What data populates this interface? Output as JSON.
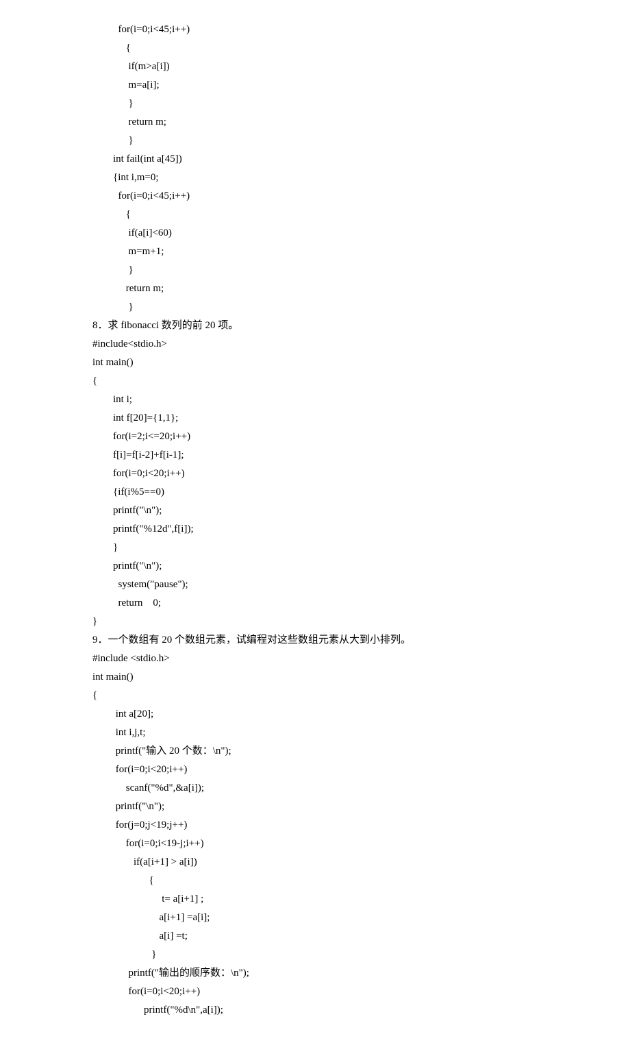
{
  "lines": [
    "          for(i=0;i<45;i++)",
    "             {",
    "              if(m>a[i])",
    "              m=a[i];",
    "              }",
    "              return m;",
    "              }",
    "        int fail(int a[45])",
    "        {int i,m=0;",
    "          for(i=0;i<45;i++)",
    "             {",
    "              if(a[i]<60)",
    "              m=m+1;",
    "              }",
    "             return m;",
    "              }",
    "",
    "8．求 fibonacci 数列的前 20 项。",
    "#include<stdio.h>",
    "int main()",
    "{",
    "        int i;",
    "        int f[20]={1,1};",
    "        for(i=2;i<=20;i++)",
    "        f[i]=f[i-2]+f[i-1];",
    "        for(i=0;i<20;i++)",
    "        {if(i%5==0)",
    "        printf(\"\\n\");",
    "        printf(\"%12d\",f[i]);",
    "        }",
    "        printf(\"\\n\");",
    "          system(\"pause\");",
    "          return    0;",
    "}",
    "9．一个数组有 20 个数组元素，试编程对这些数组元素从大到小排列。",
    "",
    "#include <stdio.h>",
    "int main()",
    "{",
    "         int a[20];",
    "         int i,j,t;",
    "         printf(\"输入 20 个数：\\n\");",
    "         for(i=0;i<20;i++)",
    "             scanf(\"%d\",&a[i]);",
    "         printf(\"\\n\");",
    "         for(j=0;j<19;j++)",
    "             for(i=0;i<19-j;i++)",
    "                if(a[i+1] > a[i])",
    "                      {",
    "                           t= a[i+1] ;",
    "                          a[i+1] =a[i];",
    "                          a[i] =t;",
    "                       }",
    "              printf(\"输出的顺序数：\\n\");",
    "              for(i=0;i<20;i++)",
    "                    printf(\"%d\\n\",a[i]);"
  ]
}
